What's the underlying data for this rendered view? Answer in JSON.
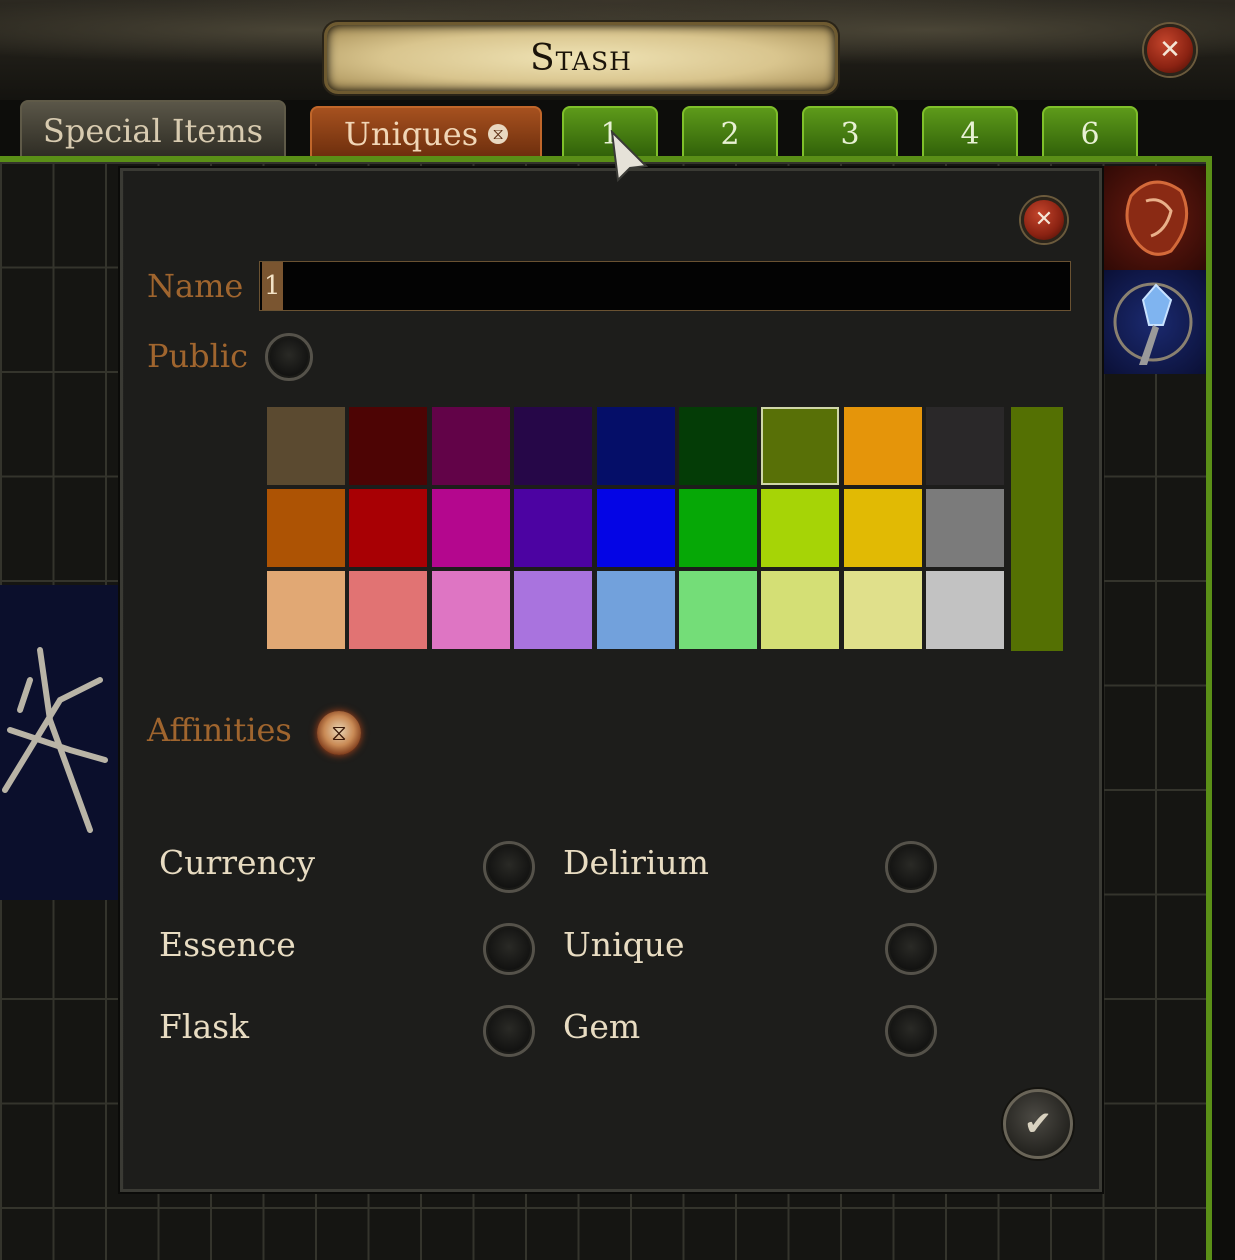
{
  "window": {
    "title": "Stash",
    "close_symbol": "✕"
  },
  "tabs": [
    {
      "label": "Special Items"
    },
    {
      "label": "Uniques",
      "affinity_icon": "affinity-glyph-icon",
      "glyph": "⧖"
    },
    {
      "label": "1",
      "active": true
    },
    {
      "label": "2"
    },
    {
      "label": "3"
    },
    {
      "label": "4"
    },
    {
      "label": "6"
    }
  ],
  "dialog": {
    "close_symbol": "✕",
    "name_label": "Name",
    "name_value": "1",
    "public_label": "Public",
    "affinities_label": "Affinities",
    "affinity_glyph": "⧖",
    "confirm_symbol": "✔",
    "colors": {
      "rows": [
        [
          "#5b4a30",
          "#4d0404",
          "#620348",
          "#260748",
          "#050e68",
          "#043c06",
          "#587007",
          "#e5950a",
          "#2a2829"
        ],
        [
          "#ad5304",
          "#a80004",
          "#b4078e",
          "#4c03a2",
          "#0405e5",
          "#06a806",
          "#a6d406",
          "#e1ba04",
          "#7b7b7b"
        ],
        [
          "#e1a874",
          "#e17373",
          "#de75c3",
          "#a973de",
          "#72a1dc",
          "#74dd78",
          "#d4df75",
          "#e0e08b",
          "#c2c2c2"
        ]
      ],
      "selected": "#587007",
      "preview": "#547003"
    },
    "affinities": [
      {
        "label": "Currency",
        "enabled": false
      },
      {
        "label": "Delirium",
        "enabled": false
      },
      {
        "label": "Essence",
        "enabled": false
      },
      {
        "label": "Unique",
        "enabled": false
      },
      {
        "label": "Flask",
        "enabled": false
      },
      {
        "label": "Gem",
        "enabled": false
      }
    ]
  }
}
